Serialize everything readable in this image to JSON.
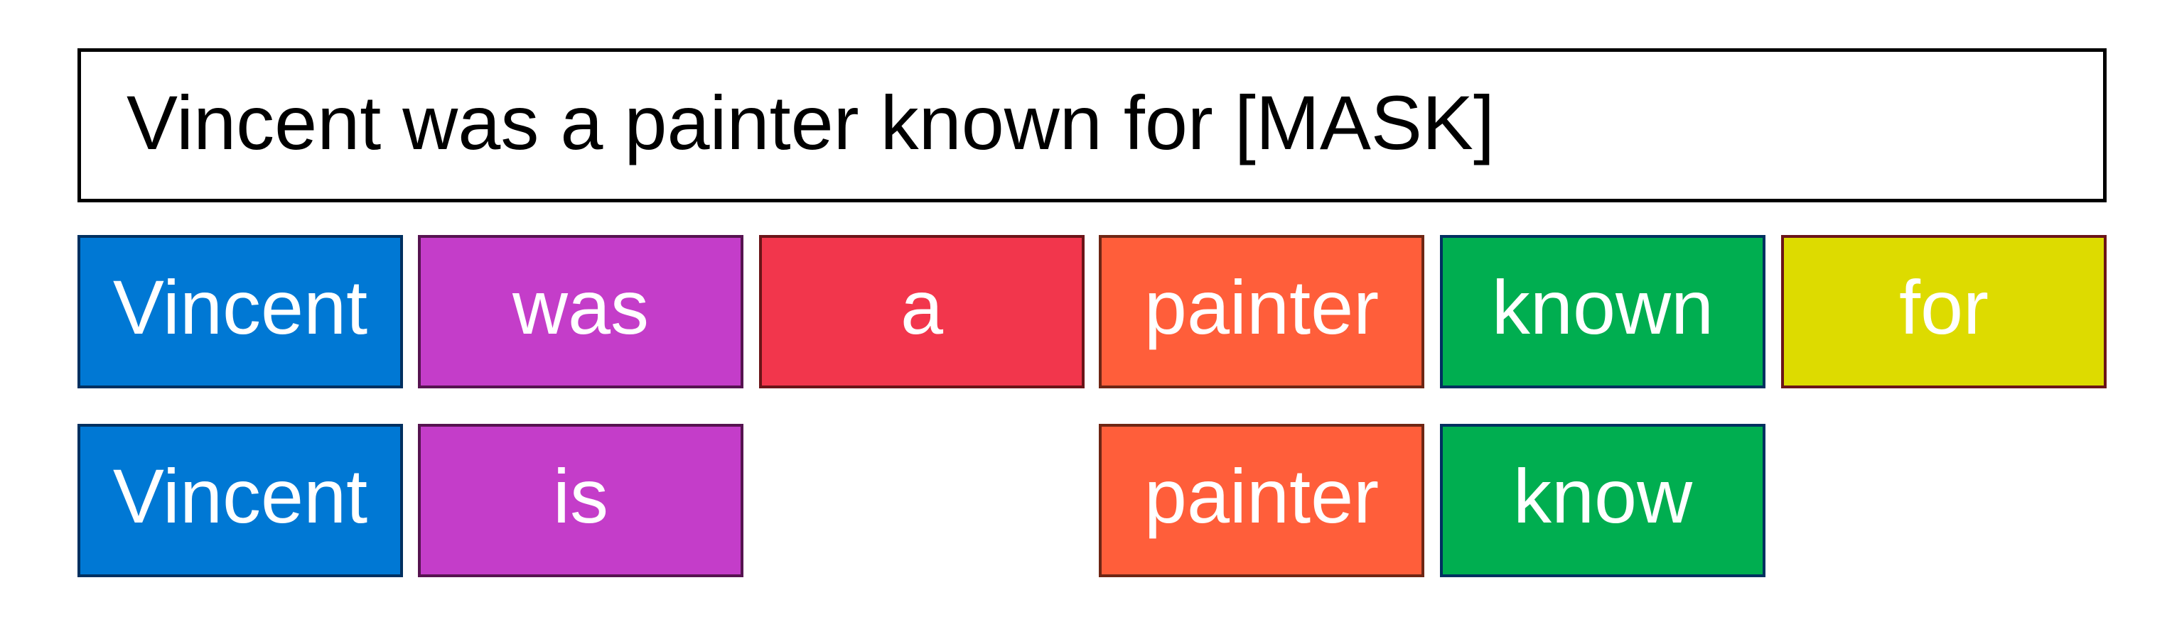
{
  "sentence": {
    "text": "Vincent was a painter known for [MASK]"
  },
  "token_rows": [
    {
      "name": "original-tokens",
      "tokens": [
        {
          "label": "Vincent",
          "color": "#0078D4",
          "border": "#003060",
          "column": 0
        },
        {
          "label": "was",
          "color": "#C43DC9",
          "border": "#561350",
          "column": 1
        },
        {
          "label": "a",
          "color": "#F2364C",
          "border": "#6B1418",
          "column": 2
        },
        {
          "label": "painter",
          "color": "#FF5E3A",
          "border": "#6E2614",
          "column": 3
        },
        {
          "label": "known",
          "color": "#00AE50",
          "border": "#003060",
          "column": 4
        },
        {
          "label": "for",
          "color": "#DDDB00",
          "border": "#6B1418",
          "column": 5
        }
      ]
    },
    {
      "name": "lemmatized-tokens",
      "tokens": [
        {
          "label": "Vincent",
          "color": "#0078D4",
          "border": "#003060",
          "column": 0
        },
        {
          "label": "is",
          "color": "#C43DC9",
          "border": "#561350",
          "column": 1
        },
        {
          "label": "painter",
          "color": "#FF5E3A",
          "border": "#6E2614",
          "column": 3
        },
        {
          "label": "know",
          "color": "#00AE50",
          "border": "#003060",
          "column": 4
        }
      ]
    }
  ]
}
